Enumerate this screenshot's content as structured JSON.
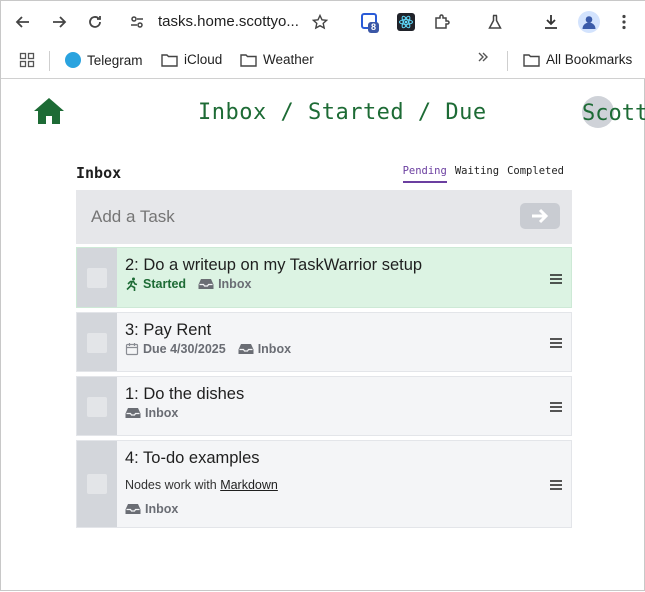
{
  "browser": {
    "url": "tasks.home.scottyo...",
    "extension_badge_count": "8",
    "bookmarks": [
      {
        "label": "Telegram",
        "icon": "telegram-icon"
      },
      {
        "label": "iCloud",
        "icon": "folder-icon"
      },
      {
        "label": "Weather",
        "icon": "folder-icon"
      }
    ],
    "all_bookmarks_label": "All Bookmarks"
  },
  "app": {
    "title": "Inbox / Started / Due",
    "user_name": "Scott",
    "accent_color": "#1d6b35",
    "tab_accent_color": "#6b3fa0"
  },
  "panel": {
    "title": "Inbox",
    "tabs": [
      "Pending",
      "Waiting",
      "Completed"
    ],
    "active_tab": "Pending",
    "add_placeholder": "Add a Task"
  },
  "tasks": [
    {
      "title": "2: Do a writeup on my TaskWarrior setup",
      "status": "Started",
      "project": "Inbox",
      "highlight": true
    },
    {
      "title": "3: Pay Rent",
      "due": "Due 4/30/2025",
      "project": "Inbox"
    },
    {
      "title": "1: Do the dishes",
      "project": "Inbox"
    },
    {
      "title": "4: To-do examples",
      "notes_prefix": "Nodes work with",
      "notes_link": "Markdown",
      "project": "Inbox"
    }
  ]
}
